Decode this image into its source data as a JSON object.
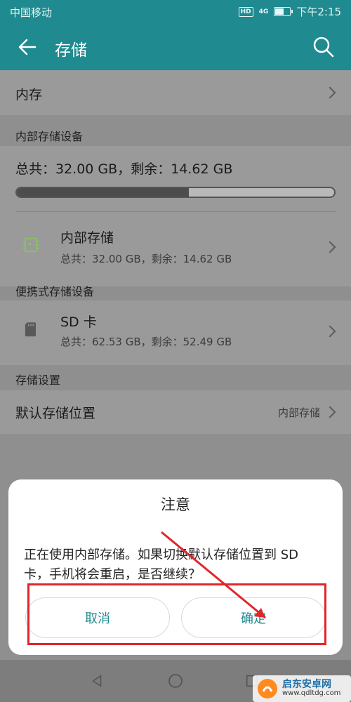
{
  "status_bar": {
    "carrier": "中国移动",
    "hd": "HD",
    "signal": "4G",
    "time": "下午2:15"
  },
  "app_bar": {
    "title": "存储"
  },
  "memory_row": {
    "label": "内存"
  },
  "internal_section": {
    "header": "内部存储设备",
    "summary": "总共：32.00 GB，剩余：14.62 GB",
    "usage_fraction": 0.543,
    "item": {
      "title": "内部存储",
      "detail": "总共：32.00 GB，剩余：14.62 GB"
    }
  },
  "portable_section": {
    "header": "便携式存储设备",
    "item": {
      "title": "SD 卡",
      "detail": "总共：62.53 GB，剩余：52.49 GB"
    }
  },
  "settings_section": {
    "header": "存储设置",
    "default_location": {
      "label": "默认存储位置",
      "value": "内部存储"
    }
  },
  "dialog": {
    "title": "注意",
    "message": "正在使用内部存储。如果切换默认存储位置到 SD 卡，手机将会重启，是否继续？",
    "cancel_label": "取消",
    "confirm_label": "确定"
  },
  "watermark": {
    "text": "启东安卓网",
    "url": "www.qdltdg.com"
  },
  "colors": {
    "accent": "#1f8a8f",
    "highlight": "#e0262b"
  }
}
